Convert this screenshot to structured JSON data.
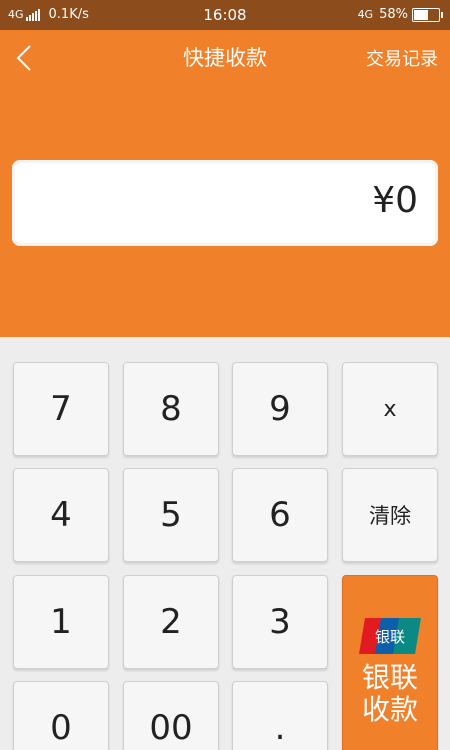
{
  "status_bar": {
    "network_left": "4G",
    "speed": "0.1K/s",
    "time": "16:08",
    "network_right": "4G",
    "battery": "58%",
    "battery_level": 0.58
  },
  "header": {
    "title": "快捷收款",
    "records_label": "交易记录"
  },
  "amount": {
    "display": "¥0"
  },
  "keypad": {
    "keys": [
      "7",
      "8",
      "9",
      "x",
      "4",
      "5",
      "6",
      "清除",
      "1",
      "2",
      "3",
      "0",
      "00",
      "."
    ],
    "pay_label_line1": "银联",
    "pay_label_line2": "收款",
    "logo_text": "银联"
  },
  "colors": {
    "accent": "#f0802a",
    "status_bar": "#8c4c1c",
    "keypad_bg": "#ededed"
  },
  "icons": {
    "back": "chevron-left-icon",
    "unionpay": "unionpay-logo-icon"
  }
}
